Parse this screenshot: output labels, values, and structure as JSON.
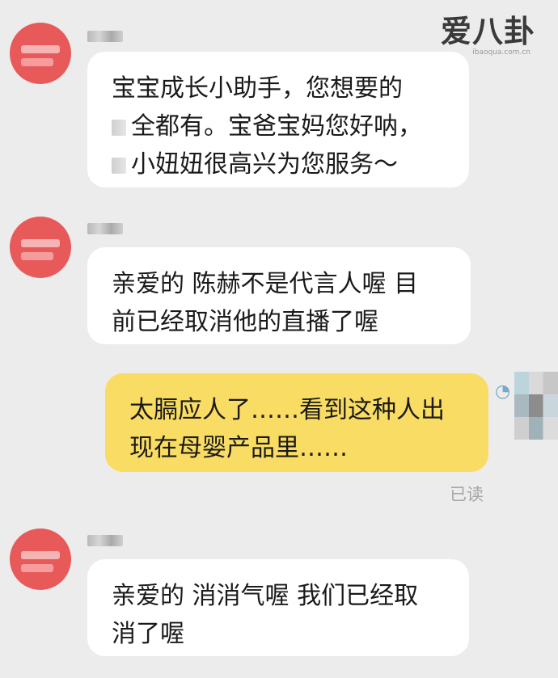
{
  "watermark": {
    "main": "爱八卦",
    "sub": "ibaoqua.com.cn"
  },
  "messages": [
    {
      "sender": "other",
      "lines": [
        "宝宝成长小助手，您想要的",
        "全都有。宝爸宝妈您好呐，",
        "小妞妞很高兴为您服务～"
      ]
    },
    {
      "sender": "other",
      "lines": [
        "亲爱的 陈赫不是代言人喔  目",
        "前已经取消他的直播了喔"
      ]
    },
    {
      "sender": "self",
      "lines": [
        "太膈应人了……看到这种人出",
        "现在母婴产品里……"
      ],
      "status": "已读"
    },
    {
      "sender": "other",
      "lines": [
        "亲爱的 消消气喔  我们已经取",
        "消了喔"
      ]
    }
  ],
  "colors": {
    "background": "#ececec",
    "bubble_other": "#ffffff",
    "bubble_self": "#f9dc63",
    "avatar": "#e85a5a"
  }
}
